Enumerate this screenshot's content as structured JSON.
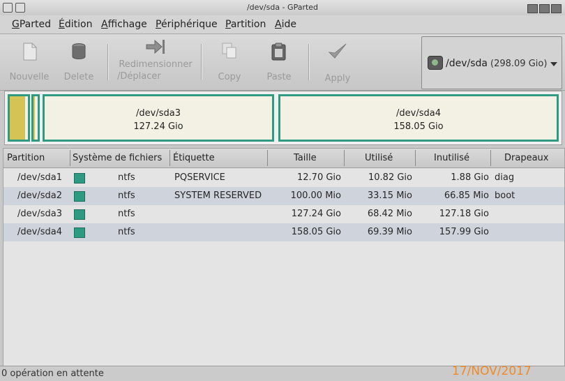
{
  "window": {
    "title": "/dev/sda - GParted"
  },
  "menu": [
    "GParted",
    "Édition",
    "Affichage",
    "Périphérique",
    "Partition",
    "Aide"
  ],
  "toolbar": {
    "new": "Nouvelle",
    "delete": "Delete",
    "resize_1": "Redimensionner",
    "resize_2": "/Déplacer",
    "copy": "Copy",
    "paste": "Paste",
    "apply": "Apply"
  },
  "device": {
    "name": "/dev/sda",
    "size": "(298.09 Gio)"
  },
  "diskmap": {
    "sda3": {
      "name": "/dev/sda3",
      "size": "127.24 Gio"
    },
    "sda4": {
      "name": "/dev/sda4",
      "size": "158.05 Gio"
    }
  },
  "table": {
    "headers": [
      "Partition",
      "Système de fichiers",
      "Étiquette",
      "Taille",
      "Utilisé",
      "Inutilisé",
      "Drapeaux"
    ],
    "rows": [
      {
        "partition": "/dev/sda1",
        "fs": "ntfs",
        "label": "PQSERVICE",
        "size": "12.70 Gio",
        "used": "10.82 Gio",
        "unused": "1.88 Gio",
        "flags": "diag"
      },
      {
        "partition": "/dev/sda2",
        "fs": "ntfs",
        "label": "SYSTEM RESERVED",
        "size": "100.00 Mio",
        "used": "33.15 Mio",
        "unused": "66.85 Mio",
        "flags": "boot"
      },
      {
        "partition": "/dev/sda3",
        "fs": "ntfs",
        "label": "",
        "size": "127.24 Gio",
        "used": "68.42 Mio",
        "unused": "127.18 Gio",
        "flags": ""
      },
      {
        "partition": "/dev/sda4",
        "fs": "ntfs",
        "label": "",
        "size": "158.05 Gio",
        "used": "69.39 Mio",
        "unused": "157.99 Gio",
        "flags": ""
      }
    ]
  },
  "status": {
    "message": "0 opération en attente"
  },
  "timestamp": "17/NOV/2017",
  "colors": {
    "ntfs": "#2e9a82",
    "used_fill": "#d4c455",
    "selected_row": "#cfd4dc"
  }
}
